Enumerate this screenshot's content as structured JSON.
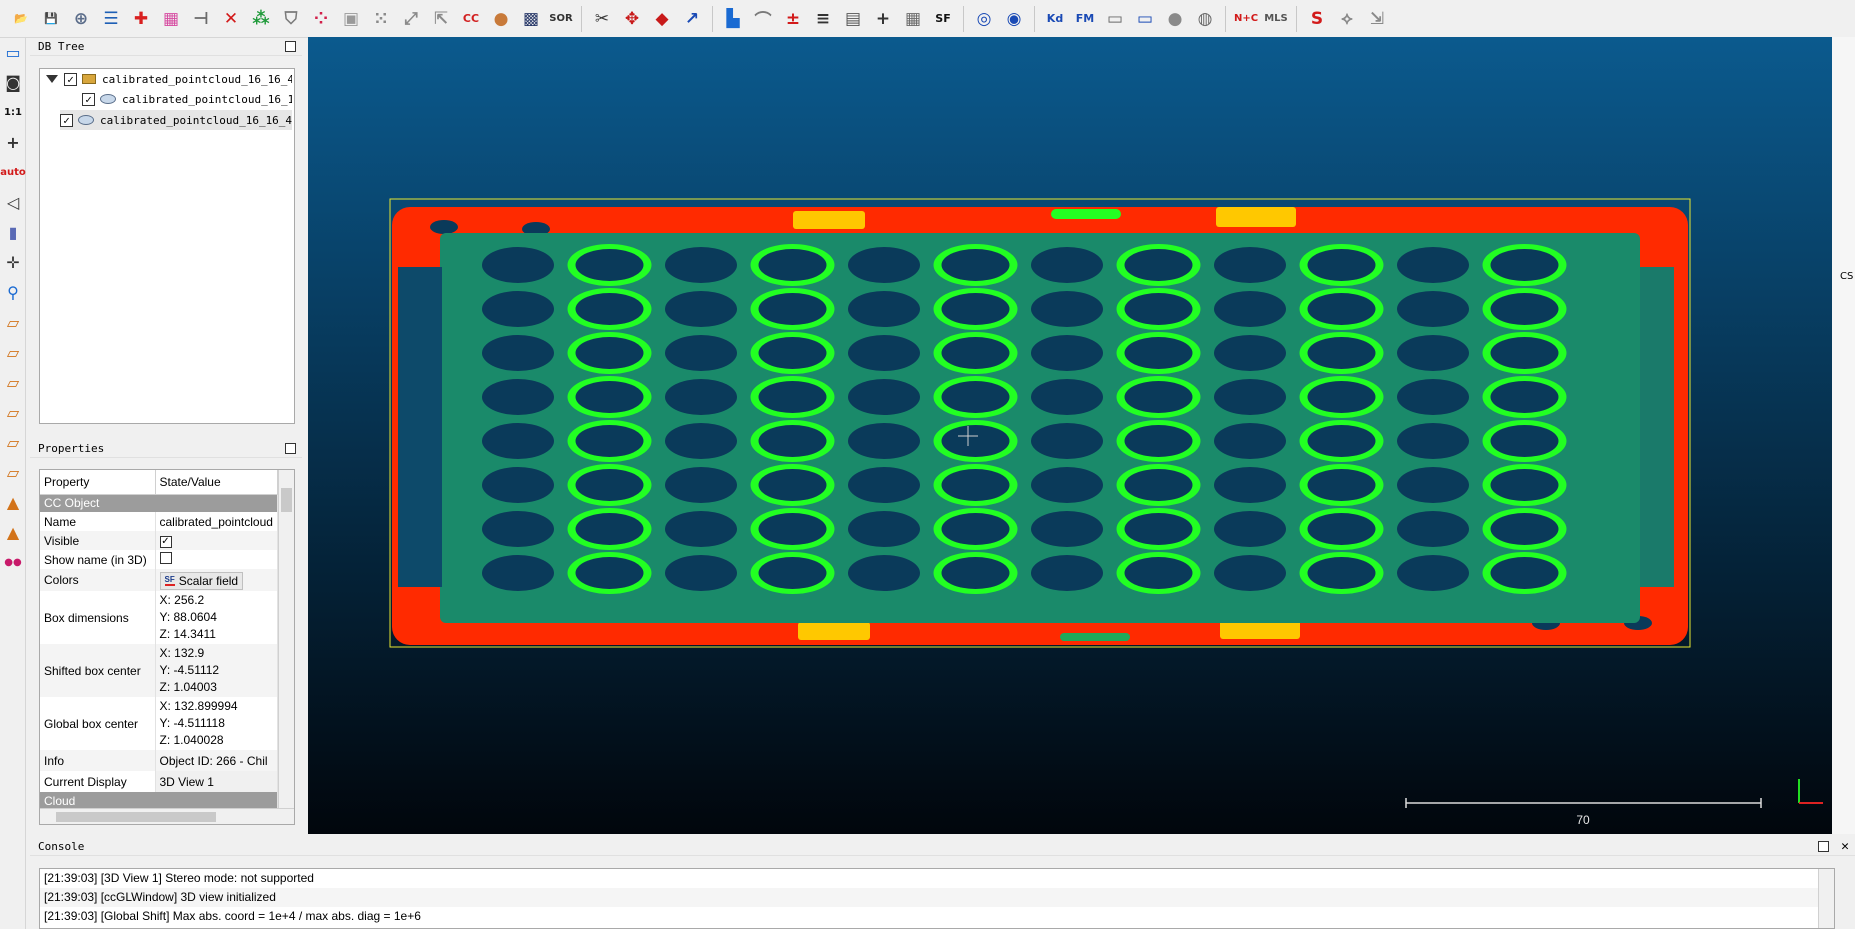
{
  "toolbar": {
    "buttons": [
      {
        "name": "open-icon",
        "glyph": "📂",
        "color": "#4a7ab8"
      },
      {
        "name": "save-icon",
        "glyph": "💾",
        "color": "#2b4f86"
      },
      {
        "name": "pick-rotation-center-icon",
        "glyph": "⊕",
        "color": "#5b6d8a"
      },
      {
        "name": "list-icon",
        "glyph": "☰",
        "color": "#1e5fb5"
      },
      {
        "name": "add-point-icon",
        "glyph": "✚",
        "color": "#d92020"
      },
      {
        "name": "color-scale-icon",
        "glyph": "▦",
        "color": "#d64aa0"
      },
      {
        "name": "merge-icon",
        "glyph": "⊣",
        "color": "#6b6b6b"
      },
      {
        "name": "delete-icon",
        "glyph": "✕",
        "color": "#d21818"
      },
      {
        "name": "sample-points-icon",
        "glyph": "⁂",
        "color": "#1f9a3a"
      },
      {
        "name": "filter-icon",
        "glyph": "⛉",
        "color": "#7a7a7a"
      },
      {
        "name": "subsample-icon",
        "glyph": "⁘",
        "color": "#d2204a"
      },
      {
        "name": "octree-icon",
        "glyph": "▣",
        "color": "#9a9a9a"
      },
      {
        "name": "scatter-icon",
        "glyph": "⁙",
        "color": "#8a8a8a"
      },
      {
        "name": "resample-icon",
        "glyph": "⤢",
        "color": "#8a8a8a"
      },
      {
        "name": "normals-icon",
        "glyph": "⇱",
        "color": "#8a8a8a"
      },
      {
        "name": "cc-compare-icon",
        "glyph": "CC",
        "color": "#d22020"
      },
      {
        "name": "cloud-mesh-icon",
        "glyph": "●",
        "color": "#c87a3a"
      },
      {
        "name": "checkerboard-icon",
        "glyph": "▩",
        "color": "#2a3a6a"
      },
      {
        "name": "sor-icon",
        "glyph": "SOR",
        "color": "#333333"
      },
      {
        "name": "sep",
        "glyph": "",
        "color": ""
      },
      {
        "name": "scissors-icon",
        "glyph": "✂",
        "color": "#3a3a3a"
      },
      {
        "name": "translate-icon",
        "glyph": "✥",
        "color": "#c81a1a"
      },
      {
        "name": "plane-icon",
        "glyph": "◆",
        "color": "#c81a1a"
      },
      {
        "name": "scalar-arrow-icon",
        "glyph": "↗",
        "color": "#1a4ab5"
      },
      {
        "name": "sep",
        "glyph": "",
        "color": ""
      },
      {
        "name": "histogram-icon",
        "glyph": "▙",
        "color": "#1a6ad2"
      },
      {
        "name": "sf-curve-icon",
        "glyph": "⌒",
        "color": "#7a7a7a"
      },
      {
        "name": "sf-minmax-icon",
        "glyph": "±",
        "color": "#d21a1a"
      },
      {
        "name": "sf-filter-icon",
        "glyph": "≡",
        "color": "#333333"
      },
      {
        "name": "sf-table-icon",
        "glyph": "▤",
        "color": "#555555"
      },
      {
        "name": "plus-icon",
        "glyph": "+",
        "color": "#333333"
      },
      {
        "name": "calculator-icon",
        "glyph": "▦",
        "color": "#6a6a6a"
      },
      {
        "name": "sf-icon",
        "glyph": "SF",
        "color": "#111111"
      },
      {
        "name": "sep",
        "glyph": "",
        "color": ""
      },
      {
        "name": "canupo-create-icon",
        "glyph": "◎",
        "color": "#1a4ab5"
      },
      {
        "name": "canupo-classify-icon",
        "glyph": "◉",
        "color": "#1a4ab5"
      },
      {
        "name": "sep",
        "glyph": "",
        "color": ""
      },
      {
        "name": "kd-tree-icon",
        "glyph": "Kd",
        "color": "#1a4ab5"
      },
      {
        "name": "fm-icon",
        "glyph": "FM",
        "color": "#1a4ab5"
      },
      {
        "name": "projection-icon",
        "glyph": "▭",
        "color": "#6a6a6a"
      },
      {
        "name": "export-icon",
        "glyph": "▭",
        "color": "#1a4ab5"
      },
      {
        "name": "sphere-icon",
        "glyph": "●",
        "color": "#8a8a8a"
      },
      {
        "name": "globe-icon",
        "glyph": "◍",
        "color": "#6a6a6a"
      },
      {
        "name": "sep",
        "glyph": "",
        "color": ""
      },
      {
        "name": "normal-curvature-icon",
        "glyph": "N+C",
        "color": "#d21a1a"
      },
      {
        "name": "mls-icon",
        "glyph": "MLS",
        "color": "#555555"
      },
      {
        "name": "sep",
        "glyph": "",
        "color": ""
      },
      {
        "name": "s-curve-icon",
        "glyph": "S",
        "color": "#d21a1a"
      },
      {
        "name": "registration-icon",
        "glyph": "⟡",
        "color": "#8a8a8a"
      },
      {
        "name": "transfer-icon",
        "glyph": "⇲",
        "color": "#8a8a8a"
      }
    ]
  },
  "left_toolbar": {
    "buttons": [
      {
        "name": "fullscreen-icon",
        "glyph": "▭",
        "color": "#1a6ad2"
      },
      {
        "name": "camera-icon",
        "glyph": "◙",
        "color": "#333333"
      },
      {
        "name": "zoom-1to1-icon",
        "glyph": "1:1",
        "color": "#111111"
      },
      {
        "name": "crosshair-icon",
        "glyph": "+",
        "color": "#333333"
      },
      {
        "name": "auto-pick-icon",
        "glyph": "auto",
        "color": "#d21a1a"
      },
      {
        "name": "perspective-icon",
        "glyph": "◁",
        "color": "#333333"
      },
      {
        "name": "ortho-icon",
        "glyph": "▮",
        "color": "#5a6ab5"
      },
      {
        "name": "pivot-icon",
        "glyph": "✛",
        "color": "#333333"
      },
      {
        "name": "zoom-icon",
        "glyph": "⚲",
        "color": "#1a6ad2"
      },
      {
        "name": "view-top-icon",
        "glyph": "▱",
        "color": "#d2731a"
      },
      {
        "name": "view-front-icon",
        "glyph": "▱",
        "color": "#d2731a"
      },
      {
        "name": "view-left-icon",
        "glyph": "▱",
        "color": "#d2731a"
      },
      {
        "name": "view-back-icon",
        "glyph": "▱",
        "color": "#d2731a"
      },
      {
        "name": "view-right-icon",
        "glyph": "▱",
        "color": "#d2731a"
      },
      {
        "name": "view-bottom-icon",
        "glyph": "▱",
        "color": "#d2731a"
      },
      {
        "name": "front-view-icon",
        "glyph": "▲",
        "color": "#d2731a"
      },
      {
        "name": "back-view-icon",
        "glyph": "▲",
        "color": "#d2731a"
      },
      {
        "name": "stereo-icon",
        "glyph": "●●",
        "color": "#c81a6a"
      }
    ]
  },
  "db_tree": {
    "title": "DB Tree",
    "items": [
      {
        "label": "calibrated_pointcloud_16_16_4…",
        "checked": "✓"
      },
      {
        "label": "calibrated_pointcloud_16_1…",
        "checked": "✓"
      },
      {
        "label": "calibrated_pointcloud_16_16_4…",
        "checked": "✓"
      }
    ]
  },
  "properties": {
    "title": "Properties",
    "header": {
      "property": "Property",
      "value": "State/Value"
    },
    "section_cc_object": "CC Object",
    "section_cloud": "Cloud",
    "rows": {
      "name": {
        "label": "Name",
        "value": "calibrated_pointcloud"
      },
      "visible": {
        "label": "Visible",
        "value": "✓"
      },
      "show_name": {
        "label": "Show name (in 3D)",
        "value": ""
      },
      "colors": {
        "label": "Colors",
        "value": "Scalar field",
        "badge": "SF"
      },
      "box_dimensions": {
        "label": "Box dimensions",
        "x": "X: 256.2",
        "y": "Y: 88.0604",
        "z": "Z: 14.3411"
      },
      "shifted_box_center": {
        "label": "Shifted box center",
        "x": "X: 132.9",
        "y": "Y: -4.51112",
        "z": "Z: 1.04003"
      },
      "global_box_center": {
        "label": "Global box center",
        "x": "X: 132.899994",
        "y": "Y: -4.511118",
        "z": "Z: 1.040028"
      },
      "info": {
        "label": "Info",
        "value": "Object ID: 266 - Chil"
      },
      "current_display": {
        "label": "Current Display",
        "value": "3D View 1"
      }
    }
  },
  "view3d": {
    "scale_label": "70",
    "right_strip_label": "CS",
    "colors": {
      "bg_top": "#0b5a8e",
      "bg_bottom": "#01060c",
      "frame": "#e6e632",
      "tray_red": "#ff2a00",
      "tray_body": "#1a8a6a",
      "hole": "#0a3a5a",
      "ring": "#22ff22",
      "yellow": "#ffc800"
    },
    "tray": {
      "rows": 8,
      "cols": 12
    }
  },
  "console": {
    "title": "Console",
    "lines": [
      "[21:39:03] [3D View 1] Stereo mode: not supported",
      "[21:39:03] [ccGLWindow] 3D view initialized",
      "[21:39:03] [Global Shift] Max abs. coord = 1e+4 / max abs. diag = 1e+6"
    ]
  }
}
